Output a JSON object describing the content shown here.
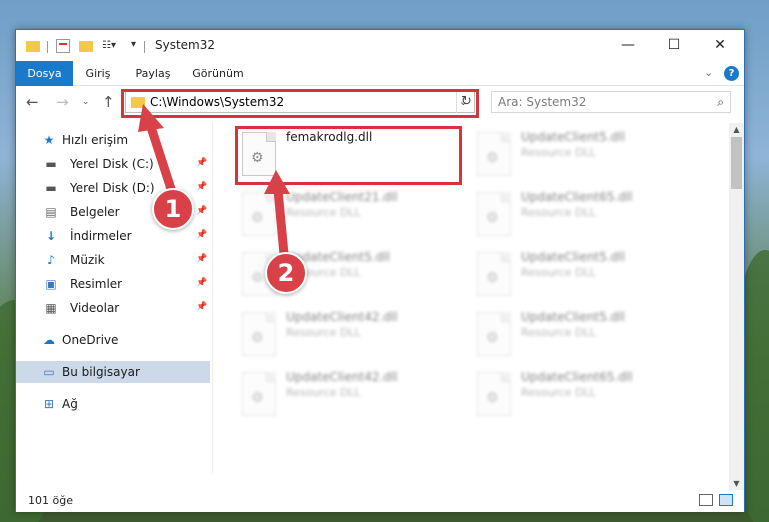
{
  "window": {
    "title": "System32",
    "controls": {
      "minimize": "—",
      "maximize": "☐",
      "close": "✕"
    }
  },
  "ribbon": {
    "tabs": [
      {
        "label": "Dosya",
        "active": true
      },
      {
        "label": "Giriş",
        "active": false
      },
      {
        "label": "Paylaş",
        "active": false
      },
      {
        "label": "Görünüm",
        "active": false
      }
    ],
    "expand_icon": "chevron-down-icon",
    "help_icon": "help-icon"
  },
  "address_bar": {
    "path": "C:\\Windows\\System32",
    "search_placeholder": "Ara: System32"
  },
  "sidebar": {
    "items": [
      {
        "label": "Hızlı erişim",
        "icon": "star-icon",
        "pinned": false
      },
      {
        "label": "Yerel Disk (C:)",
        "icon": "drive-icon",
        "pinned": true
      },
      {
        "label": "Yerel Disk (D:)",
        "icon": "drive-icon",
        "pinned": true
      },
      {
        "label": "Belgeler",
        "icon": "document-icon",
        "pinned": true
      },
      {
        "label": "İndirmeler",
        "icon": "download-icon",
        "pinned": true
      },
      {
        "label": "Müzik",
        "icon": "music-icon",
        "pinned": true
      },
      {
        "label": "Resimler",
        "icon": "image-icon",
        "pinned": true
      },
      {
        "label": "Videolar",
        "icon": "video-icon",
        "pinned": true
      },
      {
        "label": "OneDrive",
        "icon": "cloud-icon",
        "pinned": false
      },
      {
        "label": "Bu bilgisayar",
        "icon": "computer-icon",
        "pinned": false,
        "selected": true
      },
      {
        "label": "Ağ",
        "icon": "network-icon",
        "pinned": false
      }
    ]
  },
  "files": [
    {
      "name": "femakrodlg.dll",
      "type": "",
      "highlighted": true
    },
    {
      "name": "UpdateClient5.dll",
      "type": "Resource DLL"
    },
    {
      "name": "UpdateClient21.dll",
      "type": "Resource DLL"
    },
    {
      "name": "UpdateClient65.dll",
      "type": "Resource DLL"
    },
    {
      "name": "UpdateClient5.dll",
      "type": "Resource DLL"
    },
    {
      "name": "UpdateClient5.dll",
      "type": "Resource DLL"
    },
    {
      "name": "UpdateClient42.dll",
      "type": "Resource DLL"
    },
    {
      "name": "UpdateClient5.dll",
      "type": "Resource DLL"
    },
    {
      "name": "UpdateClient42.dll",
      "type": "Resource DLL"
    },
    {
      "name": "UpdateClient65.dll",
      "type": "Resource DLL"
    }
  ],
  "status": {
    "item_count": "101 öğe"
  },
  "annotations": [
    {
      "number": "1",
      "color": "#d94148"
    },
    {
      "number": "2",
      "color": "#d94148"
    }
  ],
  "colors": {
    "accent": "#1979ca",
    "highlight_box": "#d9333a"
  }
}
